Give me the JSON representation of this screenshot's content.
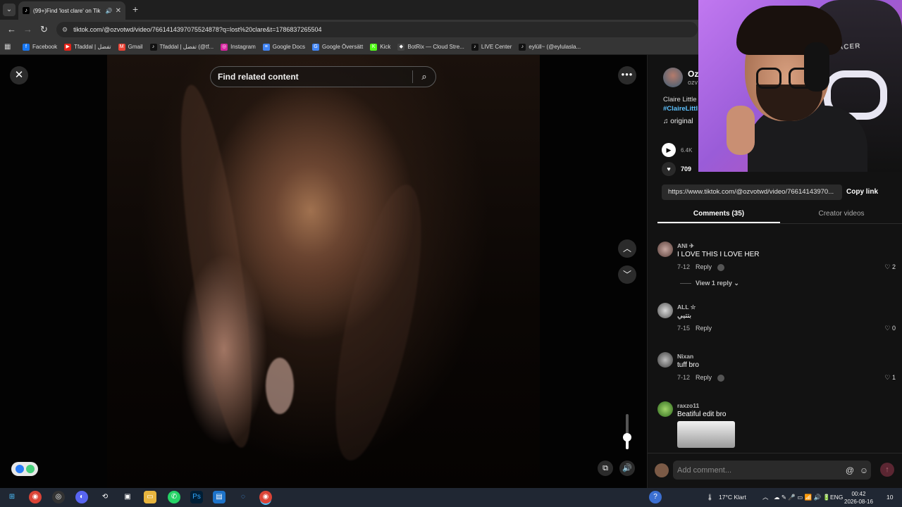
{
  "browser": {
    "tab_title": "(99+)Find 'lost clare' on Tik",
    "url": "tiktok.com/@ozvotwd/video/7661414397075524878?q=lost%20clare&t=1786837265504",
    "bookmarks": [
      {
        "label": "Facebook",
        "icon": "facebook-icon",
        "color": "#1877f2"
      },
      {
        "label": "Tfaddal | تفضل",
        "icon": "youtube-icon",
        "color": "#e62117"
      },
      {
        "label": "Gmail",
        "icon": "gmail-icon",
        "color": "#ea4335"
      },
      {
        "label": "Tfaddal | تفضل (@tf...",
        "icon": "tiktok-icon",
        "color": "#111111"
      },
      {
        "label": "Instagram",
        "icon": "instagram-icon",
        "color": "#d6249f"
      },
      {
        "label": "Google Docs",
        "icon": "docs-icon",
        "color": "#4285f4"
      },
      {
        "label": "Google Översätt",
        "icon": "translate-icon",
        "color": "#4285f4"
      },
      {
        "label": "Kick",
        "icon": "kick-icon",
        "color": "#53fc18"
      },
      {
        "label": "BotRix — Cloud Stre...",
        "icon": "botrix-icon",
        "color": "#444444"
      },
      {
        "label": "LIVE Center",
        "icon": "tiktok-icon",
        "color": "#111111"
      },
      {
        "label": "eylüll~ (@eylulasla...",
        "icon": "tiktok-icon",
        "color": "#111111"
      }
    ]
  },
  "player": {
    "search_placeholder": "Find related content",
    "volume_fraction": 0.35
  },
  "panel": {
    "author_name": "Oz",
    "author_handle": "ozv",
    "description": "Claire Little",
    "hashtag": "#ClaireLittl",
    "music": "♫  original",
    "plays": "6.4K",
    "likes": "709",
    "share_url": "https://www.tiktok.com/@ozvotwd/video/76614143970...",
    "copy_label": "Copy link",
    "tab_comments": "Comments (35)",
    "tab_creator": "Creator videos",
    "reply_label": "Reply",
    "view_reply": "View 1 reply",
    "comment_placeholder": "Add comment...",
    "comments": [
      {
        "user": "ANI ✈",
        "text": "I LOVE THIS I LOVE HER",
        "date": "7-12",
        "likes": "2"
      },
      {
        "user": "ALL ☆",
        "text": "بتتيي",
        "date": "7-15",
        "likes": "0"
      },
      {
        "user": "Nixan",
        "text": "tuff bro",
        "date": "7-12",
        "likes": "1"
      },
      {
        "user": "raxzo11",
        "text": "Beatiful edit bro",
        "date": "",
        "likes": ""
      }
    ]
  },
  "webcam": {
    "chair_text": "DXRACER"
  },
  "taskbar": {
    "weather": "17°C  Klart",
    "lang": "ENG",
    "time": "00:42",
    "date": "2026-08-16",
    "notif": "10"
  }
}
